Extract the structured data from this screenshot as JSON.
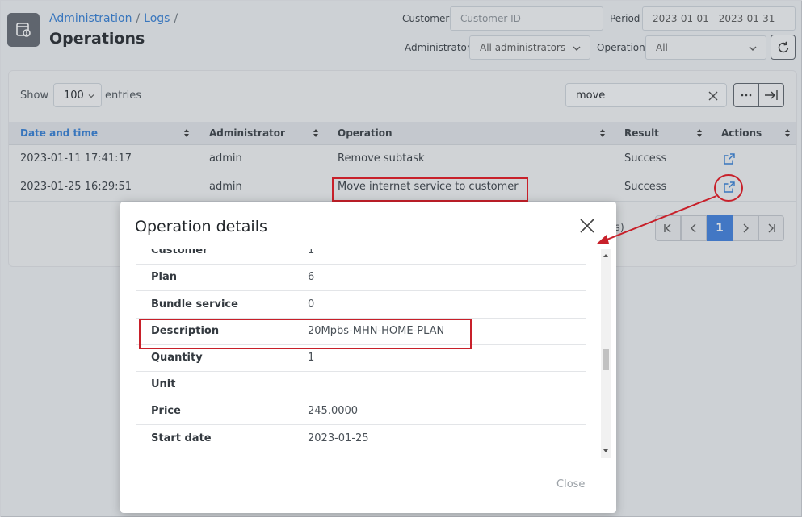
{
  "header": {
    "breadcrumb": [
      "Administration",
      "Logs"
    ],
    "title": "Operations"
  },
  "filters": {
    "customer_label": "Customer",
    "customer_placeholder": "Customer ID",
    "period_label": "Period",
    "period_value": "2023-01-01 - 2023-01-31",
    "administrator_label": "Administrator",
    "administrator_value": "All administrators",
    "operation_label": "Operation",
    "operation_value": "All"
  },
  "table_controls": {
    "show_label": "Show",
    "entries_value": "100",
    "entries_label": "entries",
    "search_value": "move"
  },
  "table": {
    "columns": [
      "Date and time",
      "Administrator",
      "Operation",
      "Result",
      "Actions"
    ],
    "rows": [
      {
        "datetime": "2023-01-11 17:41:17",
        "administrator": "admin",
        "operation": "Remove subtask",
        "result": "Success"
      },
      {
        "datetime": "2023-01-25 16:29:51",
        "administrator": "admin",
        "operation": "Move internet service to customer",
        "result": "Success"
      }
    ],
    "partial_info": "s)"
  },
  "pagination": {
    "current_page": "1"
  },
  "modal": {
    "title": "Operation details",
    "rows": [
      {
        "label": "Customer",
        "value": "1"
      },
      {
        "label": "Plan",
        "value": "6"
      },
      {
        "label": "Bundle service",
        "value": "0"
      },
      {
        "label": "Description",
        "value": "20Mpbs-MHN-HOME-PLAN"
      },
      {
        "label": "Quantity",
        "value": "1"
      },
      {
        "label": "Unit",
        "value": ""
      },
      {
        "label": "Price",
        "value": "245.0000"
      },
      {
        "label": "Start date",
        "value": "2023-01-25"
      }
    ],
    "close_label": "Close"
  },
  "colors": {
    "accent": "#3b7ddd",
    "link": "#2f7bd4",
    "annotation": "#c8202a"
  }
}
